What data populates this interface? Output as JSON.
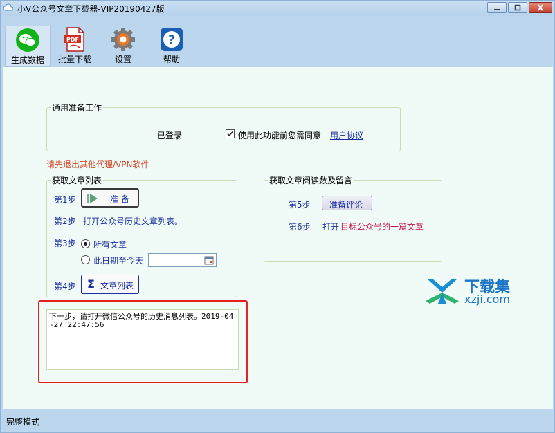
{
  "window": {
    "title": "小V公众号文章下载器-VIP20190427版"
  },
  "toolbar": {
    "items": [
      {
        "label": "生成数据",
        "icon": "wechat-icon",
        "active": true
      },
      {
        "label": "批量下载",
        "icon": "pdf-icon",
        "active": false
      },
      {
        "label": "设置",
        "icon": "gear-icon",
        "active": false
      },
      {
        "label": "帮助",
        "icon": "help-icon",
        "active": false
      }
    ]
  },
  "general": {
    "legend": "通用准备工作",
    "login_status": "已登录",
    "agree_label": "使用此功能前您需同意",
    "agree_checked": true,
    "agreement_link": "用户协议"
  },
  "warning": "请先退出其他代理/VPN软件",
  "article_list": {
    "legend": "获取文章列表",
    "step1_label": "第1步",
    "prepare_button": "准 备",
    "step2_label": "第2步",
    "step2_text": "打开公众号历史文章列表。",
    "step3_label": "第3步",
    "option_all": "所有文章",
    "option_date": "此日期至今天",
    "date_value": "",
    "step4_label": "第4步",
    "article_list_button": "文章列表"
  },
  "reading": {
    "legend": "获取文章阅读数及留言",
    "step5_label": "第5步",
    "prepare_comment_button": "准备评论",
    "step6_label": "第6步",
    "step6_prefix": "打开",
    "step6_target": "目标公众号的一篇文章"
  },
  "log": {
    "text": "下一步，请打开微信公众号的历史消息列表。2019-04-27 22:47:56"
  },
  "watermark": {
    "main": "下载集",
    "sub": "xzji.com"
  },
  "statusbar": {
    "text": "完整模式"
  },
  "colors": {
    "accent": "#1a2f9e",
    "warning": "#d0492a",
    "highlight": "#e52222",
    "panel_bg": "#f0fbf7",
    "chrome_bg": "#bcd6ee"
  }
}
